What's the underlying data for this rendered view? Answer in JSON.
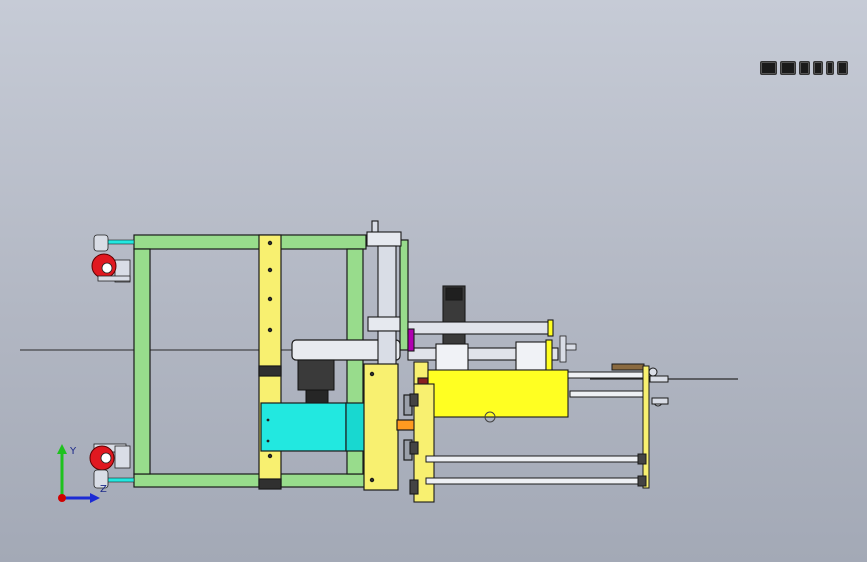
{
  "window": {
    "background_top": "#c6cbd6",
    "background_bottom": "#a3a9b6"
  },
  "view_toolbar": {
    "icons": [
      "zoom-to-fit-icon",
      "zoom-area-icon",
      "previous-view-icon",
      "section-view-icon",
      "view-orientation-icon",
      "display-style-icon"
    ]
  },
  "triad": {
    "x_label": "",
    "y_label": "Y",
    "z_label": "Z",
    "colors": {
      "x": "#d00000",
      "y": "#1ec21e",
      "z": "#1c2bd4"
    }
  },
  "model": {
    "colors": {
      "frame_green": "#98dc8c",
      "column_yellow": "#f8f070",
      "block_yellow": "#ffff22",
      "motor_cyan": "#22e8e0",
      "caster_red": "#e01820",
      "steel_gray": "#d9dde6",
      "purple": "#b000b0",
      "orange": "#ff9a20"
    }
  }
}
